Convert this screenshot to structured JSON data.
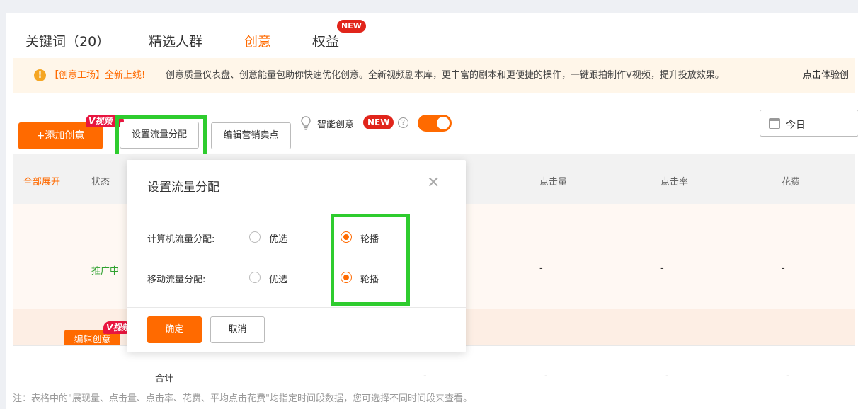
{
  "tabs": [
    {
      "label": "关键词（20）"
    },
    {
      "label": "精选人群"
    },
    {
      "label": "创意",
      "active": true
    },
    {
      "label": "权益",
      "badge": "NEW"
    }
  ],
  "notice": {
    "icon": "warning-icon",
    "highlight": "【创意工场】全新上线!",
    "text": "创意质量仪表盘、创意能量包助你快速优化创意。全新视频剧本库，更丰富的剧本和更便捷的操作，一键跟拍制作V视频，提升投放效果。",
    "link": "点击体验创"
  },
  "toolbar": {
    "add_label": "+添加创意",
    "v_badge": "V视频",
    "traffic_label": "设置流量分配",
    "selling_label": "编辑营销卖点",
    "smart_label": "智能创意",
    "smart_badge": "NEW",
    "help_glyph": "?",
    "smart_enabled": true,
    "date_value": "今日"
  },
  "table": {
    "headers": [
      "全部展开",
      "状态",
      "点击量",
      "点击率",
      "花费"
    ],
    "row1": {
      "status": "推广中",
      "values": [
        "-",
        "-",
        "-"
      ]
    },
    "row2": {
      "edit_label": "编辑创意",
      "v_badge": "V视频"
    },
    "total": {
      "label": "合计",
      "values": [
        "-",
        "-",
        "-",
        "-"
      ]
    }
  },
  "footnote": "注：表格中的\"展现量、点击量、点击率、花费、平均点击花费\"均指定时间段数据，您可选择不同时间段来查看。",
  "popover": {
    "title": "设置流量分配",
    "close_glyph": "✕",
    "rows": [
      {
        "label": "计算机流量分配:",
        "options": [
          "优选",
          "轮播"
        ],
        "selected": "轮播"
      },
      {
        "label": "移动流量分配:",
        "options": [
          "优选",
          "轮播"
        ],
        "selected": "轮播"
      }
    ],
    "confirm_label": "确定",
    "cancel_label": "取消"
  },
  "colors": {
    "accent": "#ff6a00",
    "highlight_box": "#2ecc2e",
    "new_badge": "#e1251b",
    "status_green": "#2ea12e"
  }
}
